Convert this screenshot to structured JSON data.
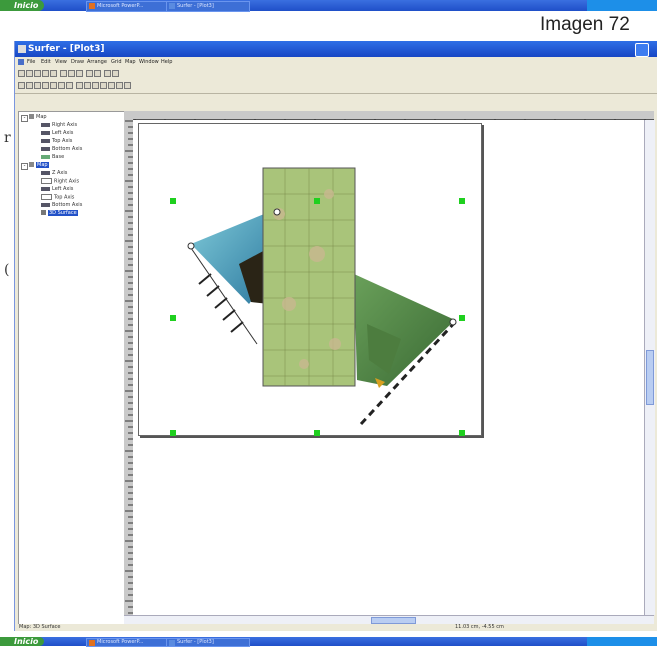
{
  "taskbar": {
    "start_label": "Inicio",
    "items": [
      "Microsoft PowerP...",
      "Surfer - [Plot3]"
    ]
  },
  "slide": {
    "label": "Imagen 72",
    "side_marks": [
      "r",
      "("
    ]
  },
  "window": {
    "title": "Surfer - [Plot3]",
    "menu": [
      "File",
      "Edit",
      "View",
      "Draw",
      "Arrange",
      "Grid",
      "Map",
      "Window",
      "Help"
    ]
  },
  "tree": {
    "items": [
      {
        "label": "Map",
        "level": 0
      },
      {
        "label": "Right Axis",
        "level": 1
      },
      {
        "label": "Left Axis",
        "level": 1
      },
      {
        "label": "Top Axis",
        "level": 1
      },
      {
        "label": "Bottom Axis",
        "level": 1
      },
      {
        "label": "Base",
        "level": 1
      },
      {
        "label": "Map",
        "level": 0,
        "selected": true
      },
      {
        "label": "Z Axis",
        "level": 1
      },
      {
        "label": "Right Axis",
        "level": 1
      },
      {
        "label": "Left Axis",
        "level": 1
      },
      {
        "label": "Top Axis",
        "level": 1
      },
      {
        "label": "Bottom Axis",
        "level": 1
      },
      {
        "label": "3D Surface",
        "level": 1,
        "selected": true
      }
    ]
  },
  "status": {
    "left": "Map: 3D Surface",
    "right": "11.03 cm, -4.55 cm"
  },
  "colors": {
    "titlebar": "#1f56d6",
    "taskbar": "#2a5fdb",
    "selection_handle": "#1fd01f",
    "start_button": "#3c9a3c"
  }
}
